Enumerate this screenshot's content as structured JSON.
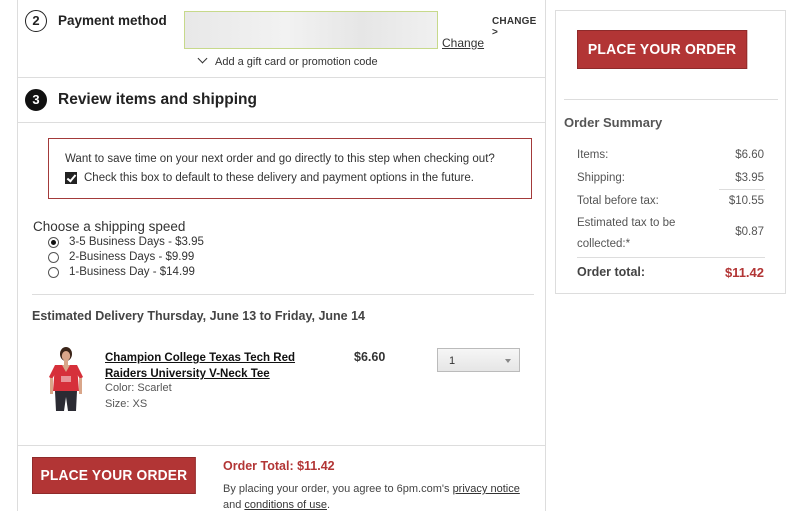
{
  "payment": {
    "step_number": "2",
    "title": "Payment method",
    "change_top": "CHANGE >",
    "change_link": "Change",
    "gift_link": "Add a gift card or promotion code"
  },
  "review": {
    "step_number": "3",
    "title": "Review items and shipping",
    "promo_question": "Want to save time on your next order and go directly to this step when checking out?",
    "promo_checkbox_label": "Check this box to default to these delivery and payment options in the future.",
    "promo_checked": true
  },
  "shipping": {
    "title": "Choose a shipping speed",
    "options": [
      {
        "label": "3-5 Business Days - $3.95",
        "selected": true
      },
      {
        "label": "2-Business Days - $9.99",
        "selected": false
      },
      {
        "label": "1-Business Day - $14.99",
        "selected": false
      }
    ]
  },
  "delivery": {
    "estimate": "Estimated Delivery Thursday, June 13 to Friday, June 14"
  },
  "product": {
    "name": "Champion College Texas Tech Red Raiders University V-Neck Tee",
    "color": "Color: Scarlet",
    "size": "Size: XS",
    "price": "$6.60",
    "quantity": "1",
    "image_icon": "red-vneck-tee-model-icon"
  },
  "footer": {
    "place_order_label": "PLACE YOUR ORDER",
    "order_total_label": "Order Total: $11.42",
    "agree_prefix": "By placing your order, you agree to 6pm.com's ",
    "privacy_link": "privacy notice",
    "agree_and": "and ",
    "conditions_link": "conditions of use",
    "agree_suffix": "."
  },
  "summary": {
    "place_order_label": "PLACE YOUR ORDER",
    "title": "Order Summary",
    "rows": [
      {
        "label": "Items:",
        "value": "$6.60"
      },
      {
        "label": "Shipping:",
        "value": "$3.95"
      },
      {
        "label": "Total before tax:",
        "value": "$10.55"
      },
      {
        "label": "Estimated tax to be collected:*",
        "value": "$0.87"
      }
    ],
    "total_label": "Order total:",
    "total_value": "$11.42"
  },
  "colors": {
    "accent": "#b23535",
    "promo_border": "#a33a3a",
    "payment_box_border": "#c7d98b"
  }
}
